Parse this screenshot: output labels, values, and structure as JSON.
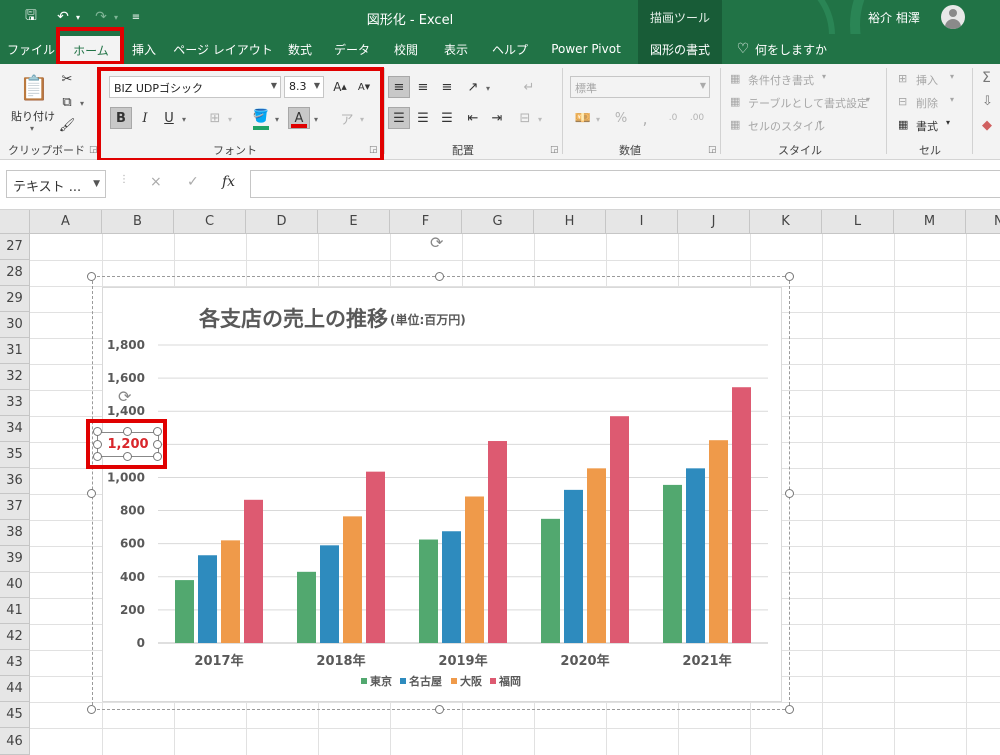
{
  "app": {
    "window_title": "図形化  -  Excel",
    "context_tab_group": "描画ツール",
    "user_name": "裕介 相澤"
  },
  "tabs": [
    {
      "label": "ファイル"
    },
    {
      "label": "ホーム"
    },
    {
      "label": "挿入"
    },
    {
      "label": "ページ レイアウト"
    },
    {
      "label": "数式"
    },
    {
      "label": "データ"
    },
    {
      "label": "校閲"
    },
    {
      "label": "表示"
    },
    {
      "label": "ヘルプ"
    },
    {
      "label": "Power Pivot"
    },
    {
      "label": "図形の書式"
    },
    {
      "label": "何をしますか"
    }
  ],
  "ribbon": {
    "clipboard": {
      "paste_label": "貼り付け",
      "group_label": "クリップボード"
    },
    "font": {
      "font_name": "BIZ UDPゴシック",
      "font_size": "8.3",
      "group_label": "フォント",
      "bold": "B",
      "italic": "I",
      "underline": "U"
    },
    "alignment": {
      "group_label": "配置"
    },
    "number": {
      "format": "標準",
      "group_label": "数値"
    },
    "styles": {
      "conditional": "条件付き書式",
      "table": "テーブルとして書式設定",
      "cell_styles": "セルのスタイル",
      "group_label": "スタイル"
    },
    "cells": {
      "insert": "挿入",
      "delete": "削除",
      "format": "書式",
      "group_label": "セル"
    }
  },
  "formula_bar": {
    "name_box": "テキスト ...",
    "fx": "fx",
    "cancel": "×",
    "enter": "✓"
  },
  "sheet": {
    "columns": [
      "A",
      "B",
      "C",
      "D",
      "E",
      "F",
      "G",
      "H",
      "I",
      "J",
      "K",
      "L",
      "M",
      "N"
    ],
    "rows": [
      "27",
      "28",
      "29",
      "30",
      "31",
      "32",
      "33",
      "34",
      "35",
      "36",
      "37",
      "38",
      "39",
      "40",
      "41",
      "42",
      "43",
      "44",
      "45",
      "46"
    ]
  },
  "selected_textbox": {
    "text": "1,200"
  },
  "colors": {
    "excel_green": "#217346",
    "highlight_red": "#e00000",
    "tokyo": "#52a86f",
    "nagoya": "#2e8bbe",
    "osaka": "#ef9a4a",
    "fukuoka": "#dd5a71"
  },
  "chart_data": {
    "type": "bar",
    "title": "各支店の売上の推移",
    "subtitle": "(単位:百万円)",
    "categories": [
      "2017年",
      "2018年",
      "2019年",
      "2020年",
      "2021年"
    ],
    "series": [
      {
        "name": "東京",
        "color": "#52a86f",
        "values": [
          380,
          430,
          625,
          750,
          955
        ]
      },
      {
        "name": "名古屋",
        "color": "#2e8bbe",
        "values": [
          530,
          590,
          675,
          925,
          1055
        ]
      },
      {
        "name": "大阪",
        "color": "#ef9a4a",
        "values": [
          620,
          765,
          885,
          1055,
          1225
        ]
      },
      {
        "name": "福岡",
        "color": "#dd5a71",
        "values": [
          865,
          1035,
          1220,
          1370,
          1545
        ]
      }
    ],
    "ylim": [
      0,
      1800
    ],
    "yticks": [
      "0",
      "200",
      "400",
      "600",
      "800",
      "1,000",
      "1,200",
      "1,400",
      "1,600",
      "1,800"
    ],
    "grid": true,
    "legend": "bottom"
  }
}
